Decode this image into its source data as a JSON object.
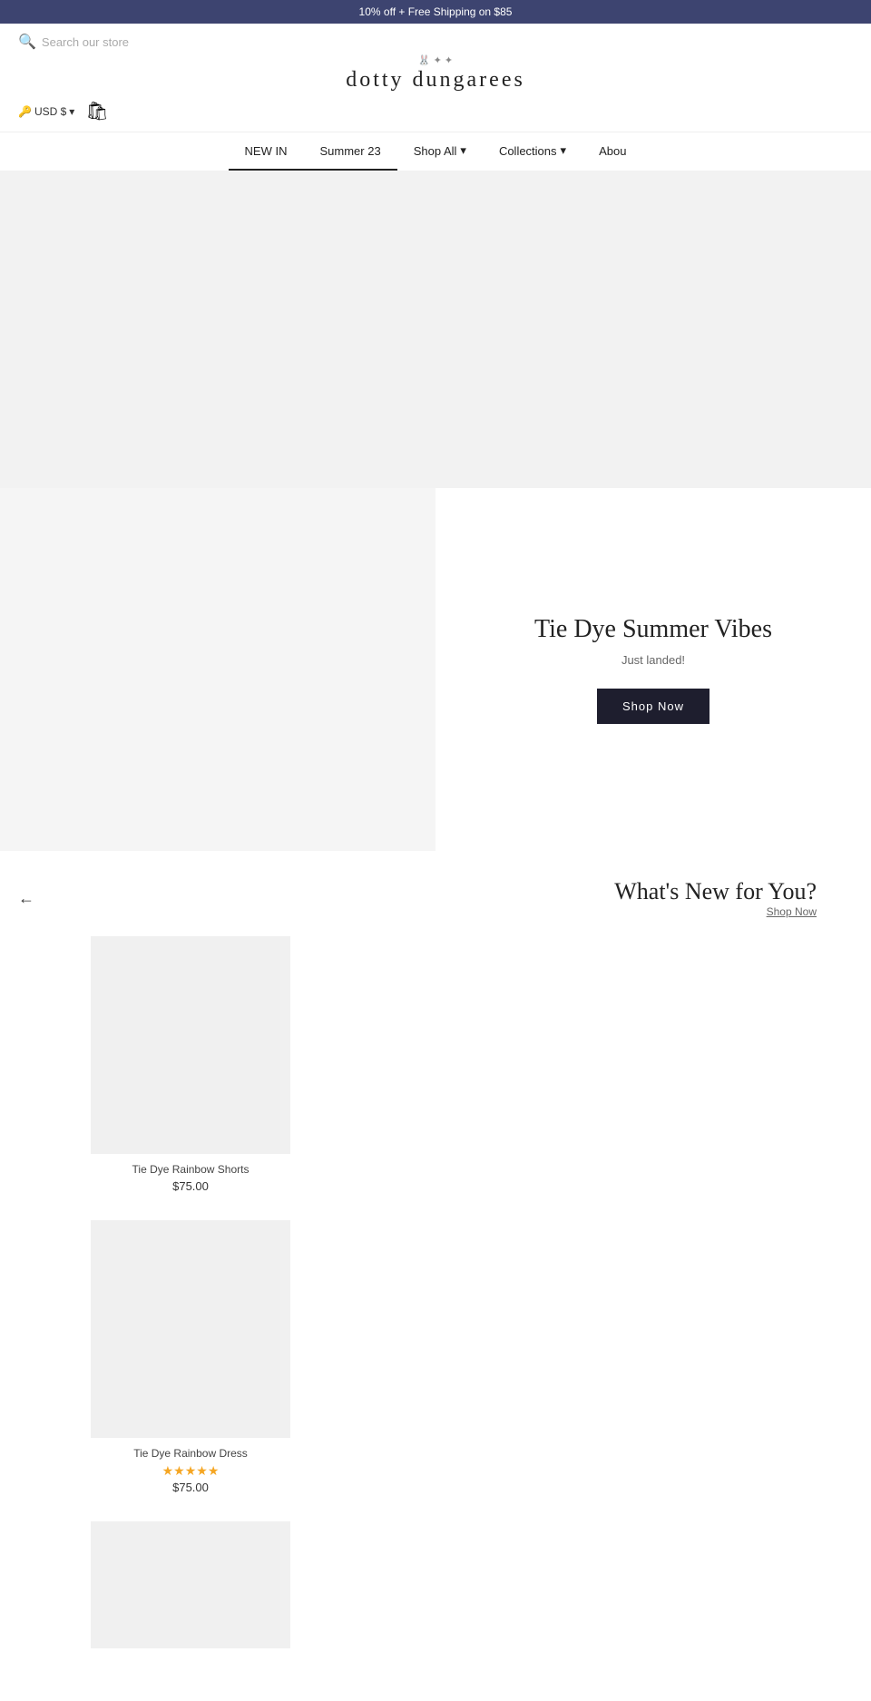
{
  "banner": {
    "text": "10% off + Free Shipping on $85"
  },
  "header": {
    "search_placeholder": "Search our store",
    "logo_text": "dotty dungarees",
    "currency": "USD $",
    "currency_icon": "🔑"
  },
  "nav": {
    "items": [
      {
        "label": "NEW IN",
        "active": true
      },
      {
        "label": "Summer 23",
        "active": true
      },
      {
        "label": "Shop All",
        "has_dropdown": true
      },
      {
        "label": "Collections",
        "has_dropdown": true
      },
      {
        "label": "Abou",
        "has_dropdown": false
      }
    ]
  },
  "feature": {
    "title": "Tie Dye Summer Vibes",
    "subtitle": "Just landed!",
    "cta_label": "Shop Now"
  },
  "new_section": {
    "title": "What's New for You?",
    "shop_now_label": "Shop Now"
  },
  "products": [
    {
      "name": "Tie Dye Rainbow Shorts",
      "price": "$75.00",
      "stars": "",
      "has_stars": false
    },
    {
      "name": "Tie Dye Rainbow Dress",
      "price": "$75.00",
      "stars": "★★★★★",
      "has_stars": true
    },
    {
      "name": "",
      "price": "",
      "stars": "",
      "has_stars": false,
      "partial": true
    }
  ]
}
